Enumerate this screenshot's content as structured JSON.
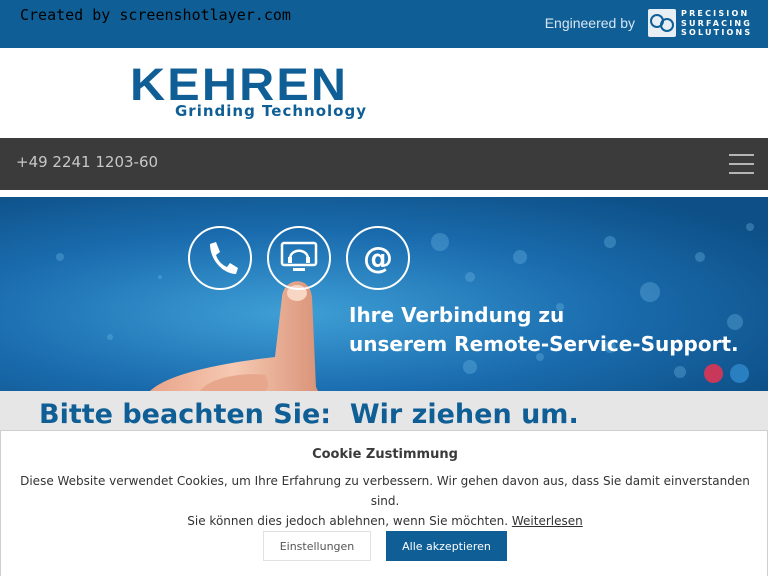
{
  "watermark": "Created by screenshotlayer.com",
  "header": {
    "engineered_by": "Engineered by",
    "partner_logo": {
      "line1": "PRECISION",
      "line2": "SURFACING",
      "line3": "SOLUTIONS"
    }
  },
  "logo": {
    "name": "KEHREN",
    "tagline": "Grinding Technology"
  },
  "nav": {
    "phone": "+49 2241 1203-60",
    "menu_icon": "hamburger-menu-icon"
  },
  "hero": {
    "line1": "Ihre Verbindung zu",
    "line2": "unserem Remote-Service-Support.",
    "icons": [
      "phone-icon",
      "headset-monitor-icon",
      "at-sign-icon"
    ],
    "slides": {
      "count": 2,
      "active": 1
    },
    "colors": {
      "active_dot": "#c8385a",
      "inactive_dot": "#2a7fc0"
    }
  },
  "notice": {
    "title": "Bitte beachten Sie:  Wir ziehen um."
  },
  "cookie": {
    "title": "Cookie Zustimmung",
    "text_line1": "Diese Website verwendet Cookies, um Ihre Erfahrung zu verbessern. Wir gehen davon aus, dass Sie damit einverstanden sind.",
    "text_line2": "Sie können dies jedoch ablehnen, wenn Sie möchten.",
    "link": "Weiterlesen",
    "settings_button": "Einstellungen",
    "accept_button": "Alle akzeptieren"
  },
  "colors": {
    "brand_blue": "#0f5f96",
    "dark_bar": "#3b3b3b"
  }
}
